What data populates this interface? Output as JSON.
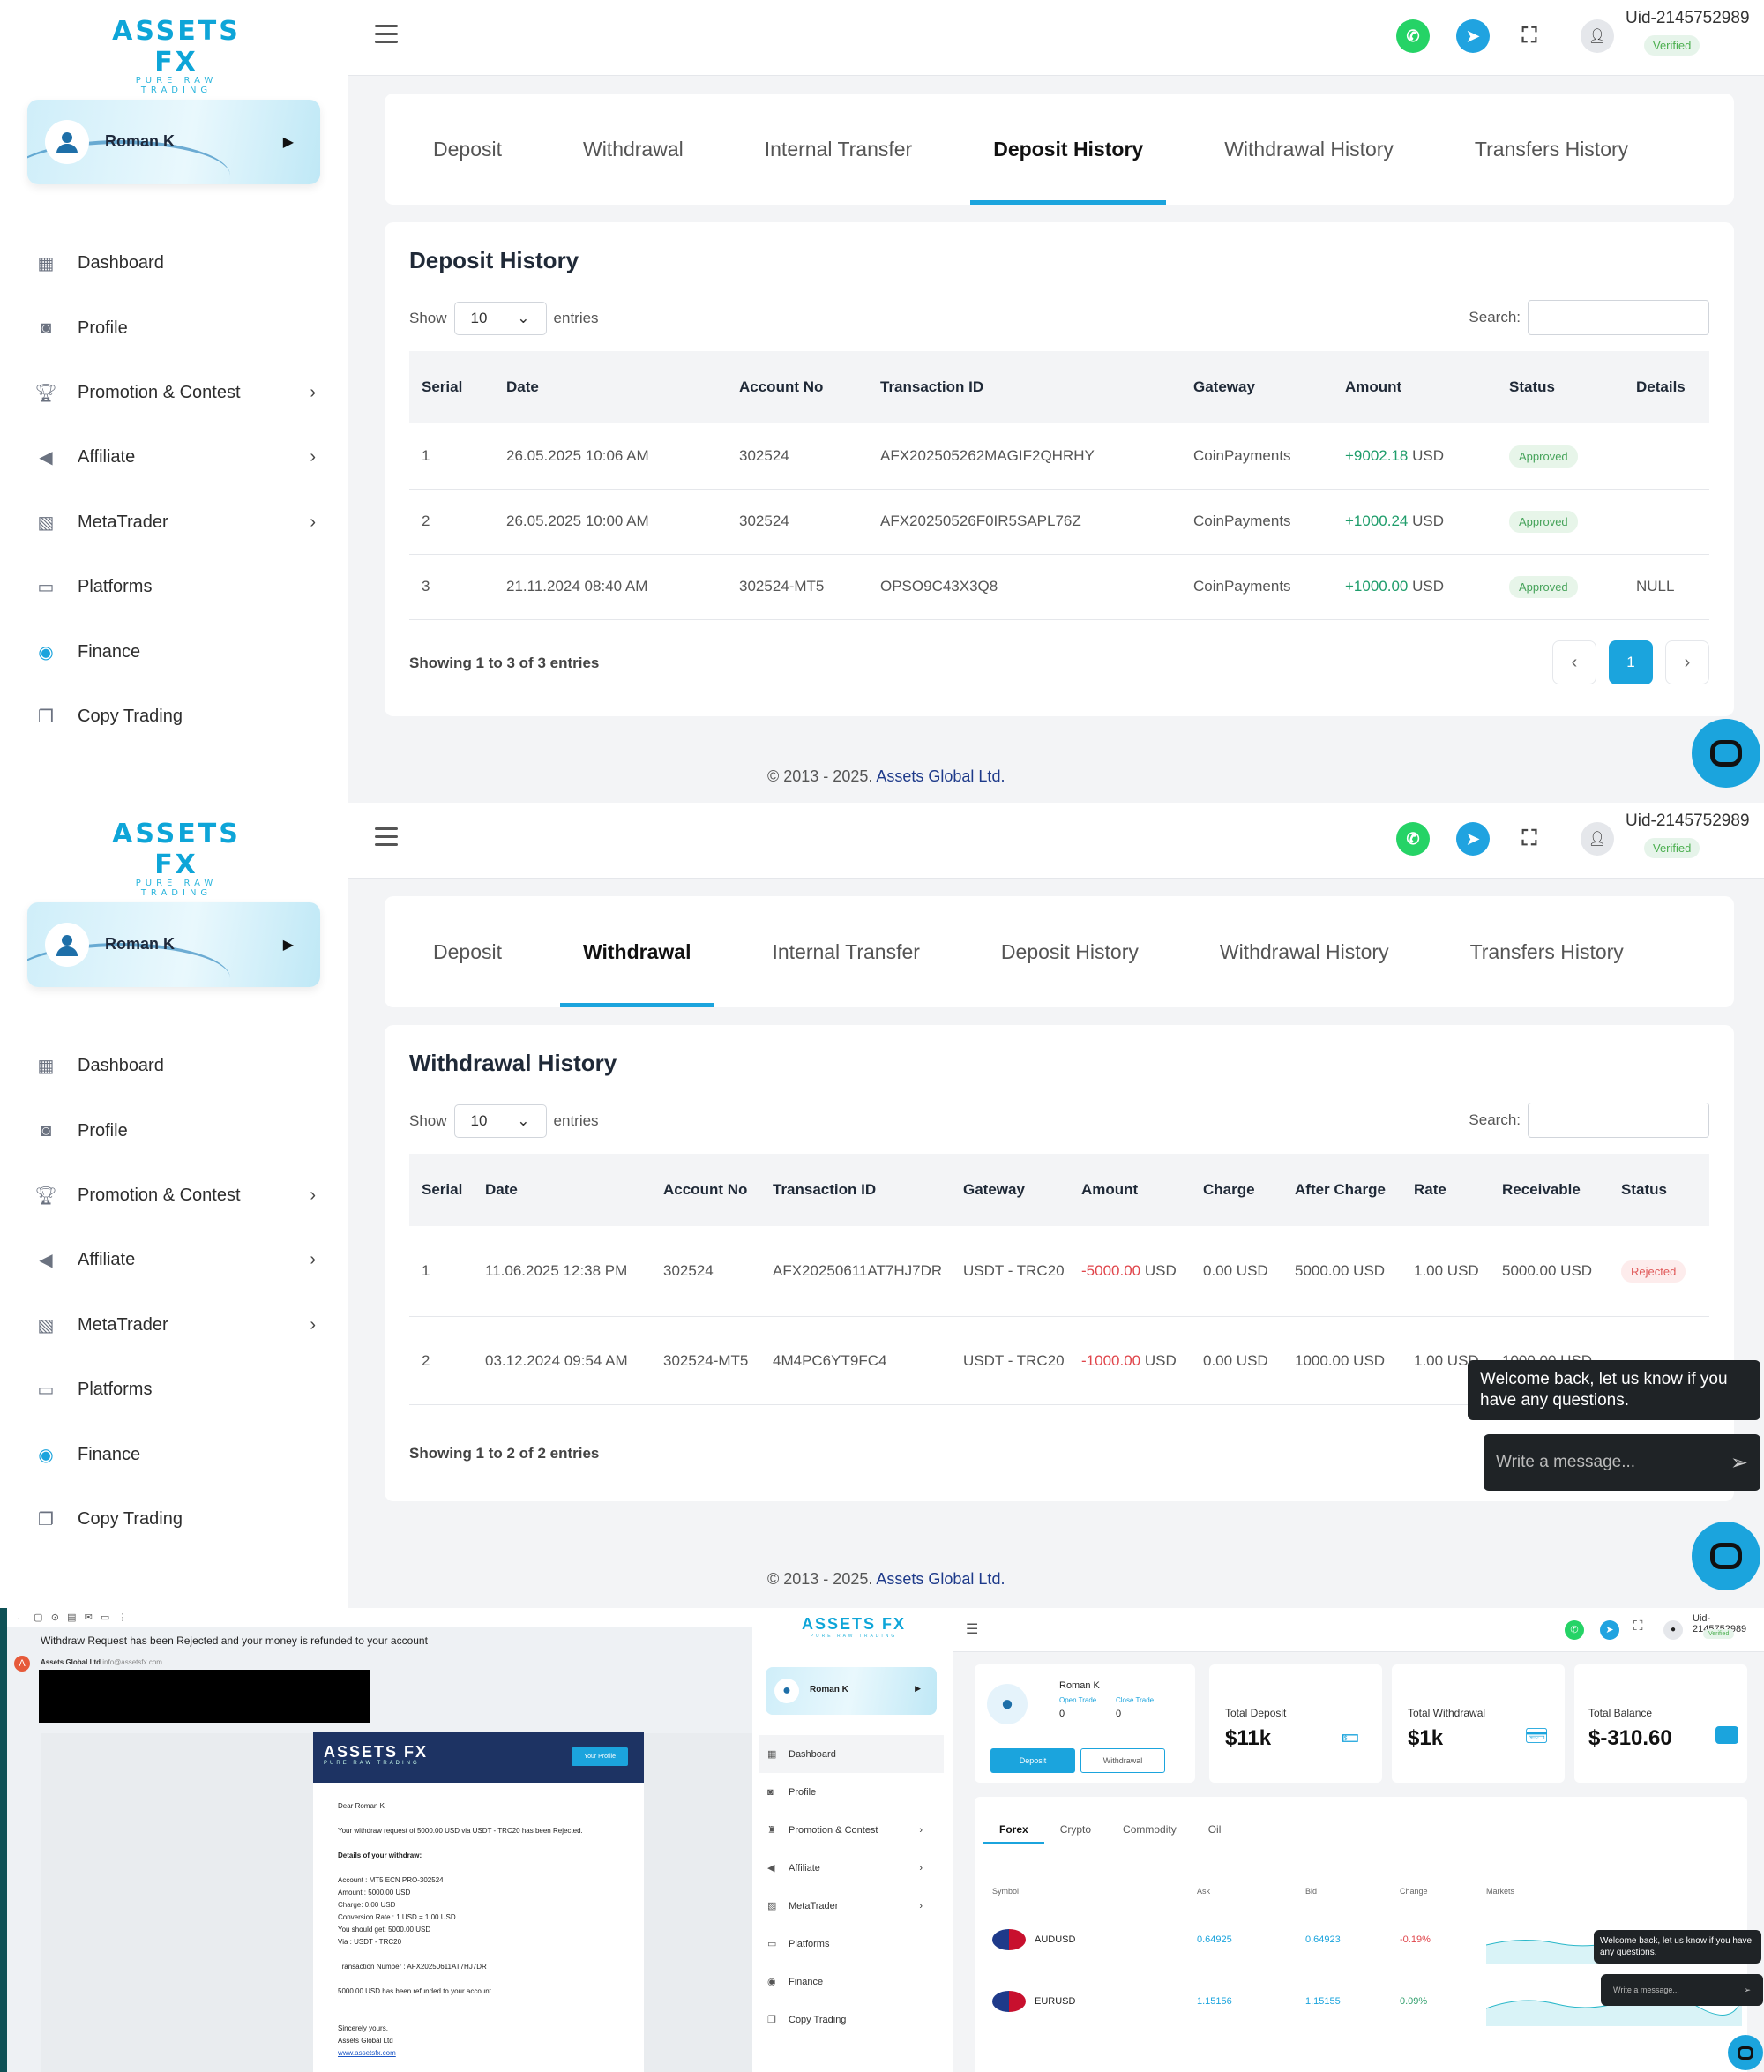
{
  "nav": {
    "user": "Roman K",
    "items": [
      {
        "label": "Dashboard",
        "icon": "grid-icon",
        "sub": false
      },
      {
        "label": "Profile",
        "icon": "user-card-icon",
        "sub": false
      },
      {
        "label": "Promotion & Contest",
        "icon": "trophy-icon",
        "sub": true
      },
      {
        "label": "Affiliate",
        "icon": "megaphone-icon",
        "sub": true
      },
      {
        "label": "MetaTrader",
        "icon": "chart-icon",
        "sub": true
      },
      {
        "label": "Platforms",
        "icon": "monitor-icon",
        "sub": false
      },
      {
        "label": "Finance",
        "icon": "coins-icon",
        "sub": false
      },
      {
        "label": "Copy Trading",
        "icon": "copy-icon",
        "sub": false
      }
    ]
  },
  "logo": {
    "main": "ASSETS FX",
    "sub": "PURE RAW TRADING"
  },
  "top": {
    "uid": "Uid-2145752989",
    "verified": "Verified"
  },
  "tabs": [
    "Deposit",
    "Withdrawal",
    "Internal Transfer",
    "Deposit History",
    "Withdrawal History",
    "Transfers History"
  ],
  "deposit": {
    "title": "Deposit History",
    "show": "Show",
    "entries_val": "10",
    "entries": "entries",
    "search": "Search:",
    "headers": [
      "Serial",
      "Date",
      "Account No",
      "Transaction ID",
      "Gateway",
      "Amount",
      "Status",
      "Details"
    ],
    "rows": [
      [
        "1",
        "26.05.2025 10:06 AM",
        "302524",
        "AFX20250526 2MAGIF2QHRHY",
        "CoinPayments",
        "+9002.18",
        "USD",
        "Approved",
        ""
      ],
      [
        "2",
        "26.05.2025 10:00 AM",
        "302524",
        "AFX20250526F0IR5SAPL76Z",
        "CoinPayments",
        "+1000.24",
        "USD",
        "Approved",
        ""
      ],
      [
        "3",
        "21.11.2024 08:40 AM",
        "302524-MT5",
        "OPSO9C43X3Q8",
        "CoinPayments",
        "+1000.00",
        "USD",
        "Approved",
        "NULL"
      ]
    ],
    "showing": "Showing 1 to 3 of 3 entries",
    "page": "1"
  },
  "withdrawal": {
    "title": "Withdrawal History",
    "show": "Show",
    "entries_val": "10",
    "entries": "entries",
    "search": "Search:",
    "headers": [
      "Serial",
      "Date",
      "Account No",
      "Transaction ID",
      "Gateway",
      "Amount",
      "Charge",
      "After Charge",
      "Rate",
      "Receivable",
      "Status"
    ],
    "rows": [
      [
        "1",
        "11.06.2025 12:38 PM",
        "302524",
        "AFX20250611AT7HJ7DR",
        "USDT - TRC20",
        "-5000.00",
        "USD",
        "0.00 USD",
        "5000.00 USD",
        "1.00 USD",
        "5000.00 USD",
        "Rejected"
      ],
      [
        "2",
        "03.12.2024 09:54 AM",
        "302524-MT5",
        "4M4PC6YT9FC4",
        "USDT - TRC20",
        "-1000.00",
        "USD",
        "0.00 USD",
        "1000.00 USD",
        "1.00 USD",
        "1000.00 USD",
        ""
      ]
    ],
    "showing": "Showing 1 to 2 of 2 entries"
  },
  "footer": {
    "copy": "© 2013 - 2025.",
    "company": "Assets Global Ltd."
  },
  "chat": {
    "welcome": "Welcome back, let us know if you have any questions.",
    "placeholder": "Write a message..."
  },
  "email": {
    "subject": "Withdraw Request has been Rejected and your money is refunded to your account",
    "sender": "Assets Global Ltd",
    "sender_addr": "info@assetsfx.com",
    "btn": "Your Profile",
    "greet": "Dear Roman K",
    "line1": "Your withdraw request of 5000.00 USD via USDT - TRC20 has been Rejected.",
    "details_title": "Details of your withdraw:",
    "details": [
      "Account : MT5 ECN PRO-302524",
      "Amount : 5000.00 USD",
      "Charge: 0.00 USD",
      "Conversion Rate : 1 USD = 1.00 USD",
      "You should get: 5000.00 USD",
      "Via : USDT - TRC20"
    ],
    "txn": "Transaction Number : AFX20250611AT7HJ7DR",
    "refund": "5000.00 USD has been refunded to your account.",
    "sign1": "Sincerely yours,",
    "sign2": "Assets Global Ltd",
    "link": "www.assetsfx.com"
  },
  "dash": {
    "user": "Roman K",
    "open": "Open Trade",
    "close": "Close Trade",
    "open_val": "0",
    "close_val": "0",
    "deposit_btn": "Deposit",
    "withdraw_btn": "Withdrawal",
    "total_deposit_label": "Total Deposit",
    "total_deposit": "$11k",
    "total_withdraw_label": "Total Withdrawal",
    "total_withdraw": "$1k",
    "balance_label": "Total Balance",
    "balance": "$-310.60",
    "mtabs": [
      "Forex",
      "Crypto",
      "Commodity",
      "Oil"
    ],
    "mheaders": [
      "Symbol",
      "Ask",
      "Bid",
      "Change",
      "Markets"
    ],
    "mrows": [
      [
        "AUDUSD",
        "0.64925",
        "0.64923",
        "-0.19%"
      ],
      [
        "EURUSD",
        "1.15156",
        "1.15155",
        "0.09%"
      ]
    ]
  }
}
